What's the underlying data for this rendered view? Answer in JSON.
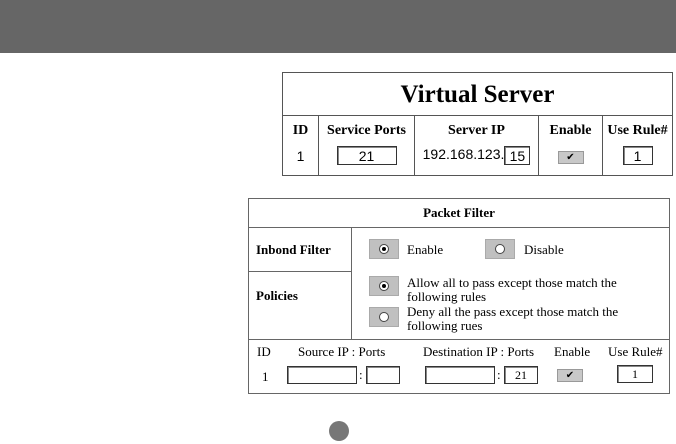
{
  "virtual_server": {
    "title": "Virtual Server",
    "headers": {
      "id": "ID",
      "service_ports": "Service Ports",
      "server_ip": "Server IP",
      "enable": "Enable",
      "use_rule": "Use Rule#"
    },
    "row": {
      "id": "1",
      "service_port": "21",
      "ip_prefix": "192.168.123.",
      "ip_last": "15",
      "enable_mark": "✔",
      "use_rule": "1"
    }
  },
  "packet_filter": {
    "title": "Packet Filter",
    "inbond_label": "Inbond Filter",
    "enable_label": "Enable",
    "disable_label": "Disable",
    "policies_label": "Policies",
    "policy_allow_line1": "Allow all to pass except those match the",
    "policy_allow_line2": "following rules",
    "policy_deny_line1": "Deny all the pass except those match the",
    "policy_deny_line2": "following rues",
    "headers": {
      "id": "ID",
      "source": "Source IP : Ports",
      "destination": "Destination IP : Ports",
      "enable": "Enable",
      "use_rule": "Use Rule#"
    },
    "row": {
      "id": "1",
      "source_ip": "",
      "source_port": "",
      "colon": ":",
      "dest_ip": "",
      "dest_port": "21",
      "enable_mark": "✔",
      "use_rule": "1"
    }
  },
  "colors": {
    "topbar": "#666666",
    "radio_bg": "#c0c0c0",
    "checkbox_bg": "#c8c8c8"
  }
}
